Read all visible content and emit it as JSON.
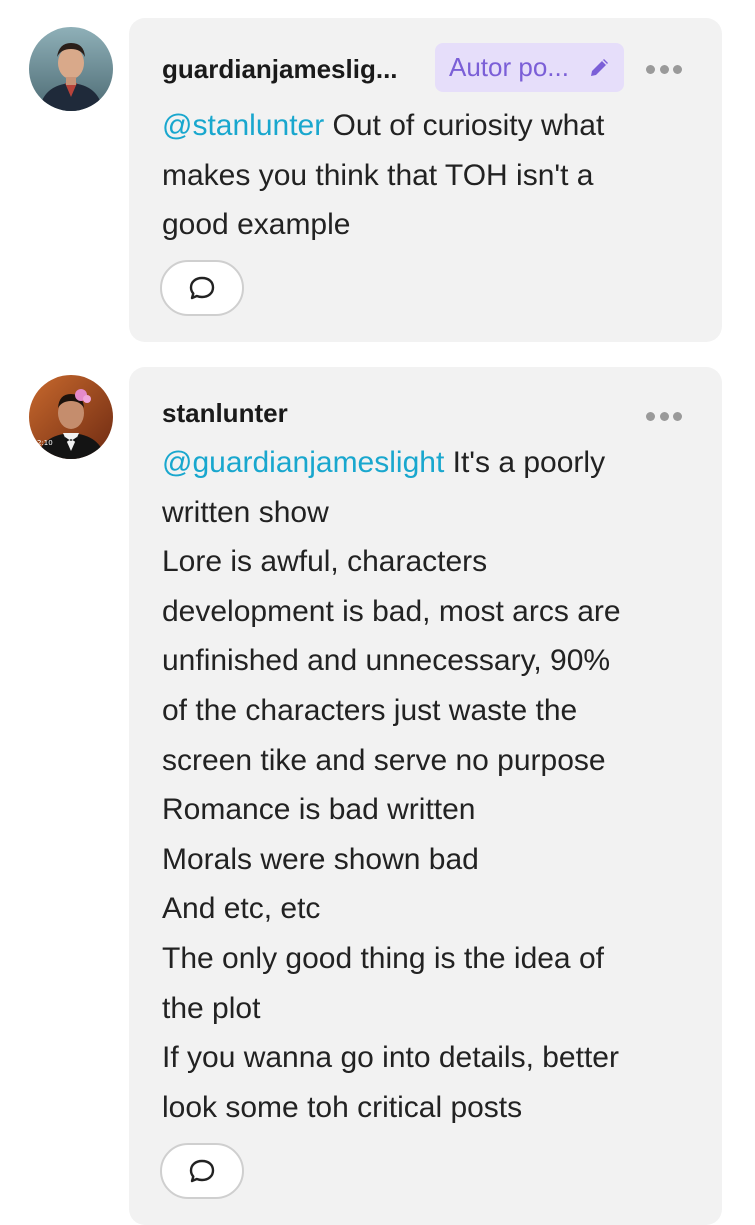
{
  "comments": [
    {
      "username": "guardianjameslig...",
      "badge_label": "Autor po...",
      "mention": "@stanlunter",
      "body_lines": [
        " Out of curiosity what",
        "makes you think that TOH isn't a",
        "good example"
      ],
      "avatar_icon": "avatar-man-dark-jacket",
      "reply_icon": "speech-bubble-icon",
      "more_icon": "more-dots-icon"
    },
    {
      "username": "stanlunter",
      "mention": "@guardianjameslight",
      "body_lines": [
        " It's a poorly",
        "written show",
        "Lore is awful, characters",
        "development is bad, most arcs are",
        "unfinished and unnecessary, 90%",
        "of the characters just waste the",
        "screen tike and serve no purpose",
        "Romance is bad written",
        "Morals were shown bad",
        "And etc, etc",
        "The only good thing is the idea of",
        "the plot",
        "If you wanna go into details, better",
        "look some toh critical posts"
      ],
      "avatar_icon": "avatar-man-tuxedo-bow",
      "reply_icon": "speech-bubble-icon",
      "more_icon": "more-dots-icon"
    }
  ],
  "colors": {
    "mention": "#19a7ce",
    "badge_bg": "#e6defa",
    "badge_text": "#7b5fd7",
    "card_bg": "#f2f2f2"
  }
}
